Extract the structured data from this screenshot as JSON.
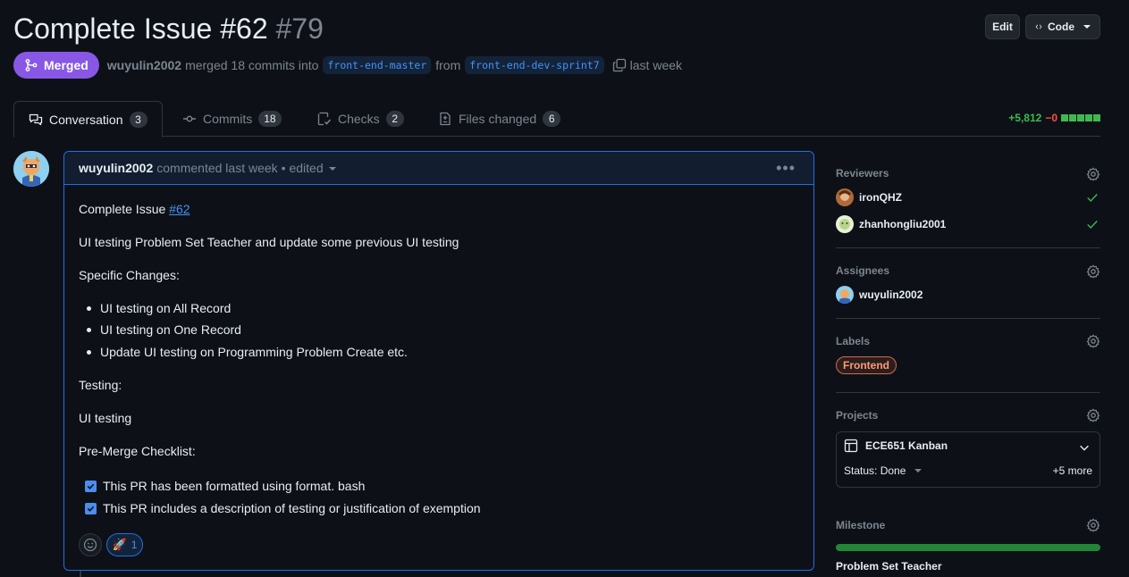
{
  "header": {
    "title": "Complete Issue #62",
    "number": "#79",
    "edit_label": "Edit",
    "code_label": "Code"
  },
  "meta": {
    "status": "Merged",
    "author": "wuyulin2002",
    "action": "merged 18 commits into",
    "base_branch": "front-end-master",
    "from_word": "from",
    "head_branch": "front-end-dev-sprint7",
    "time": "last week"
  },
  "tabs": [
    {
      "label": "Conversation",
      "count": "3"
    },
    {
      "label": "Commits",
      "count": "18"
    },
    {
      "label": "Checks",
      "count": "2"
    },
    {
      "label": "Files changed",
      "count": "6"
    }
  ],
  "diffstat": {
    "additions": "+5,812",
    "deletions": "−0"
  },
  "comment": {
    "author": "wuyulin2002",
    "action": "commented last week",
    "edited": "• edited",
    "line1_prefix": "Complete Issue ",
    "line1_link": "#62",
    "line2": "UI testing Problem Set Teacher and update some previous UI testing",
    "changes_heading": "Specific Changes:",
    "changes": [
      "UI testing on All Record",
      "UI testing on One Record",
      "Update UI testing on Programming Problem Create etc."
    ],
    "testing_heading": "Testing:",
    "testing_value": "UI testing",
    "checklist_heading": "Pre-Merge Checklist:",
    "checklist": [
      "This PR has been formatted using format. bash",
      "This PR includes a description of testing or justification of exemption"
    ],
    "reaction_count": "1"
  },
  "sidebar": {
    "reviewers_heading": "Reviewers",
    "reviewers": [
      "ironQHZ",
      "zhanhongliu2001"
    ],
    "assignees_heading": "Assignees",
    "assignees": [
      "wuyulin2002"
    ],
    "labels_heading": "Labels",
    "labels": [
      "Frontend"
    ],
    "projects_heading": "Projects",
    "project_name": "ECE651 Kanban",
    "project_status": "Status: Done",
    "project_more": "+5 more",
    "milestone_heading": "Milestone",
    "milestone_name": "Problem Set Teacher",
    "milestone_progress": 1.0
  },
  "colors": {
    "merged": "#8957e5",
    "accent": "#1f6feb",
    "link": "#4493f8",
    "success": "#3fb950",
    "danger": "#f85149",
    "label_frontend": "#d16d4a"
  }
}
